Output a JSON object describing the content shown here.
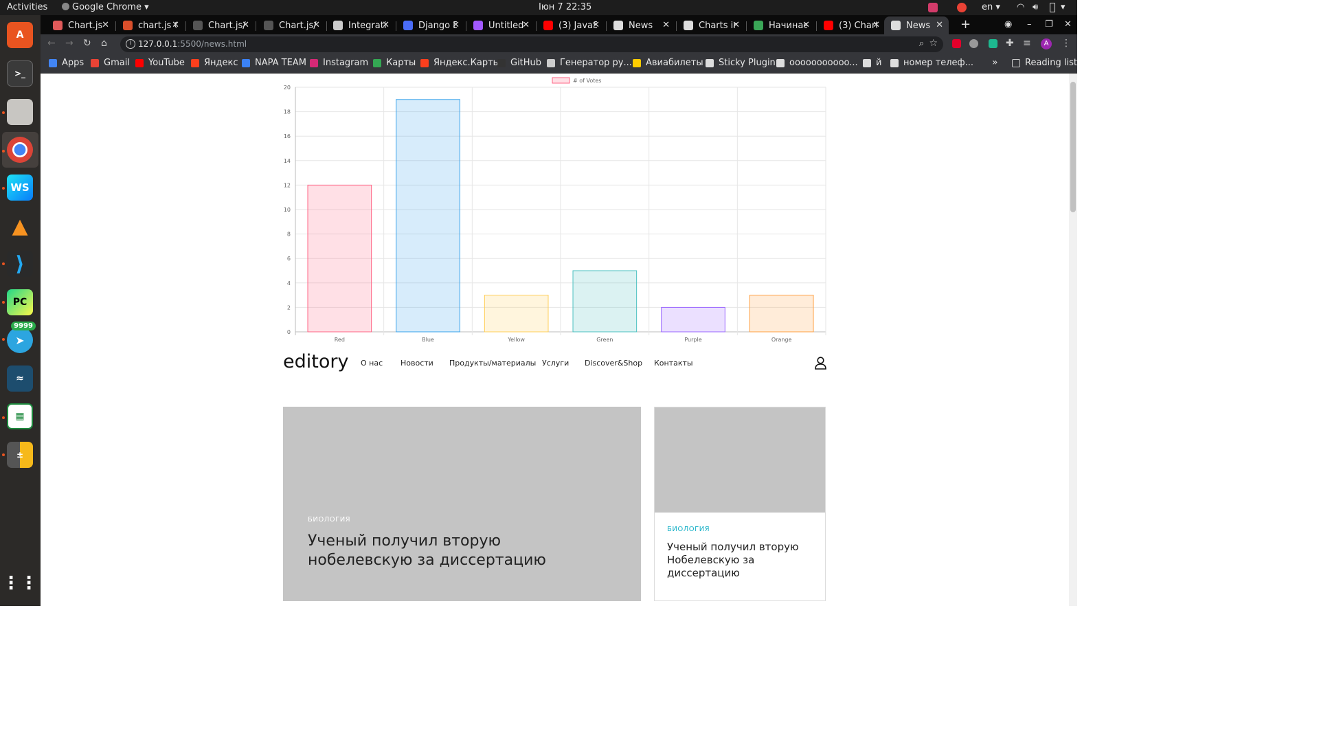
{
  "system": {
    "activities": "Activities",
    "app_name": "Google Chrome",
    "clock": "Іюн 7  22:35",
    "lang": "en"
  },
  "dock": {
    "apps": [
      "ubuntu-software",
      "terminal",
      "files",
      "chrome",
      "webstorm",
      "vlc",
      "vscode",
      "pycharm",
      "telegram",
      "mysql-workbench",
      "libreoffice-calc",
      "calculator"
    ],
    "telegram_badge": "9999"
  },
  "tabs": [
    {
      "title": "Chart.js |",
      "color": "#e05a5a"
    },
    {
      "title": "chart.js C",
      "color": "#d94f2b"
    },
    {
      "title": "Chart.js/",
      "color": "#555555"
    },
    {
      "title": "Chart.js/",
      "color": "#555555"
    },
    {
      "title": "Integrati",
      "color": "#cccccc"
    },
    {
      "title": "Django D",
      "color": "#4a6cf7"
    },
    {
      "title": "Untitled",
      "color": "#a259ff"
    },
    {
      "title": "(3) JavaS",
      "color": "#ff0000"
    },
    {
      "title": "News",
      "color": "#dddddd"
    },
    {
      "title": "Charts in",
      "color": "#dddddd"
    },
    {
      "title": "Начинае",
      "color": "#3aa757"
    },
    {
      "title": "(3) Chart",
      "color": "#ff0000"
    },
    {
      "title": "News",
      "color": "#dddddd",
      "active": true
    }
  ],
  "toolbar": {
    "url_host": "127.0.0.1",
    "url_rest": ":5500/news.html"
  },
  "bookmarks": [
    {
      "label": "Apps",
      "color": "#4285f4"
    },
    {
      "label": "Gmail",
      "color": "#ea4335"
    },
    {
      "label": "YouTube",
      "color": "#ff0000"
    },
    {
      "label": "Яндекс",
      "color": "#fc3f1d"
    },
    {
      "label": "NAPA TEAM",
      "color": "#3b82f6"
    },
    {
      "label": "Instagram",
      "color": "#d62976"
    },
    {
      "label": "Карты",
      "color": "#34a853"
    },
    {
      "label": "Яндекс.Карты",
      "color": "#fc3f1d"
    },
    {
      "label": "GitHub",
      "color": "#333333"
    },
    {
      "label": "Генератор ру...",
      "color": "#cccccc"
    },
    {
      "label": "Авиабилеты",
      "color": "#ffcc00"
    },
    {
      "label": "Sticky Plugin",
      "color": "#dddddd"
    },
    {
      "label": "ooooooooooo...",
      "color": "#dddddd"
    },
    {
      "label": "й",
      "color": "#dddddd"
    },
    {
      "label": "номер телеф...",
      "color": "#dddddd"
    }
  ],
  "reading_list": "Reading list",
  "chart_data": {
    "type": "bar",
    "categories": [
      "Red",
      "Blue",
      "Yellow",
      "Green",
      "Purple",
      "Orange"
    ],
    "series": [
      {
        "name": "# of Votes",
        "values": [
          12,
          19,
          3,
          5,
          2,
          3
        ]
      }
    ],
    "ylim": [
      0,
      20
    ],
    "yticks": [
      0,
      2,
      4,
      6,
      8,
      10,
      12,
      14,
      16,
      18,
      20
    ],
    "legend": "top-center",
    "grid": true,
    "fill_colors": [
      "rgba(255,99,132,0.2)",
      "rgba(54,162,235,0.2)",
      "rgba(255,206,86,0.2)",
      "rgba(75,192,192,0.2)",
      "rgba(153,102,255,0.2)",
      "rgba(255,159,64,0.2)"
    ],
    "border_colors": [
      "#ff6384",
      "#36a2eb",
      "#ffce56",
      "#4bc0c0",
      "#9966ff",
      "#ff9f40"
    ]
  },
  "site": {
    "logo": "editory",
    "nav": [
      "О нас",
      "Новости",
      "Продукты/материалы",
      "Услуги",
      "Discover&Shop",
      "Контакты"
    ]
  },
  "cards": {
    "big": {
      "category": "БИОЛОГИЯ",
      "headline": "Ученый получил вторую нобелевскую за диссертацию"
    },
    "small": {
      "category": "БИОЛОГИЯ",
      "headline": "Ученый получил вторую Нобелевскую за диссертацию"
    }
  }
}
